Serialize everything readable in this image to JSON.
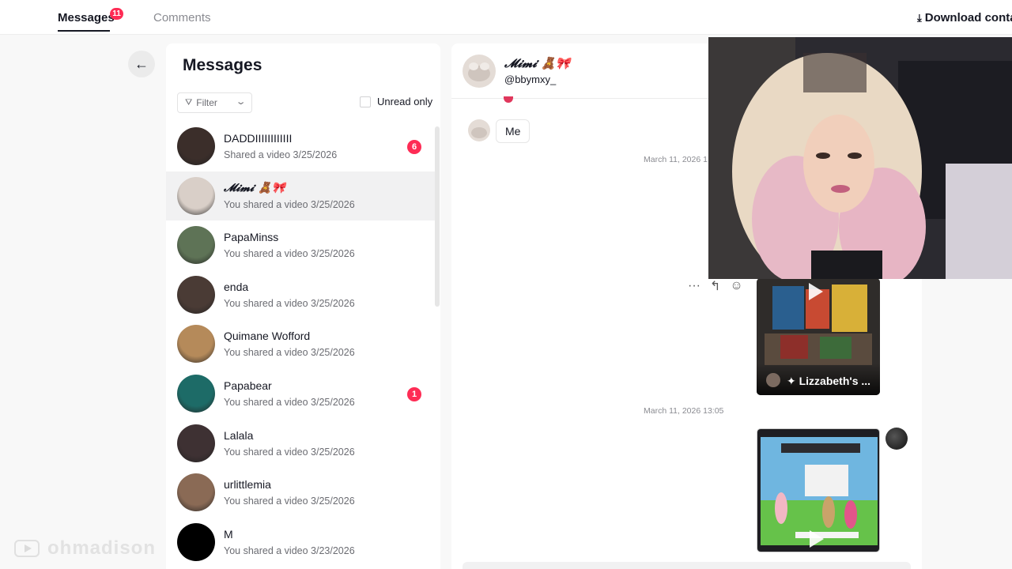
{
  "tabs": {
    "messages_label": "Messages",
    "messages_badge": "11",
    "comments_label": "Comments"
  },
  "download_label": "Download conta",
  "list": {
    "title": "Messages",
    "filter_label": "Filter",
    "unread_only_label": "Unread only",
    "conversations": [
      {
        "name": "DADDIIIIIIIIIIII",
        "subtitle": "Shared a video 3/25/2026",
        "badge": "6",
        "avatar_color": "#3b2e2a"
      },
      {
        "name": "𝓜𝓲𝓶𝓲 🧸🎀",
        "subtitle": "You shared a video 3/25/2026",
        "badge": "",
        "avatar_color": "#d9cfc8"
      },
      {
        "name": "PapaMinss",
        "subtitle": "You shared a video 3/25/2026",
        "badge": "",
        "avatar_color": "#5e7356"
      },
      {
        "name": "enda",
        "subtitle": "You shared a video 3/25/2026",
        "badge": "",
        "avatar_color": "#4a3b35"
      },
      {
        "name": "Quimane Wofford",
        "subtitle": "You shared a video 3/25/2026",
        "badge": "",
        "avatar_color": "#b58a5a"
      },
      {
        "name": "Papabear",
        "subtitle": "You shared a video 3/25/2026",
        "badge": "1",
        "avatar_color": "#1d6b67"
      },
      {
        "name": "Lalala",
        "subtitle": "You shared a video 3/25/2026",
        "badge": "",
        "avatar_color": "#3e3133"
      },
      {
        "name": "urlittlemia",
        "subtitle": "You shared a video 3/25/2026",
        "badge": "",
        "avatar_color": "#8a6a55"
      },
      {
        "name": "M",
        "subtitle": "You shared a video 3/23/2026",
        "badge": "",
        "avatar_color": "#000000"
      }
    ]
  },
  "chat": {
    "name": "𝓜𝓲𝓶𝓲 🧸🎀",
    "handle": "@bbymxy_",
    "message_text": "Me",
    "timestamp_1": "March 11, 2026 1:",
    "timestamp_2": "March 11, 2026 13:05",
    "video_card_label": "✦ Lizzabeth's ..."
  },
  "watermark_text": "ohmadison",
  "colors": {
    "accent_badge": "#fe2c55",
    "active_row": "#f1f1f2"
  }
}
